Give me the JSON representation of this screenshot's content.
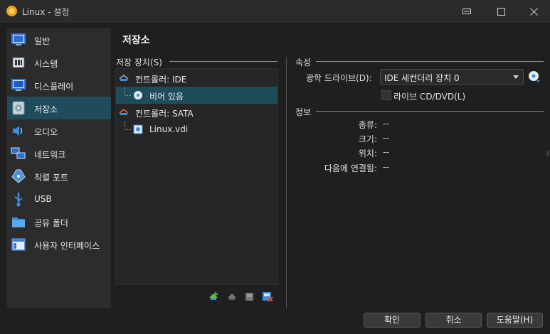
{
  "window": {
    "title": "Linux - 설정"
  },
  "sidebar": {
    "items": [
      {
        "label": "일반",
        "icon": "general-icon"
      },
      {
        "label": "시스템",
        "icon": "system-icon"
      },
      {
        "label": "디스플레이",
        "icon": "display-icon"
      },
      {
        "label": "저장소",
        "icon": "storage-icon",
        "selected": true
      },
      {
        "label": "오디오",
        "icon": "audio-icon"
      },
      {
        "label": "네트워크",
        "icon": "network-icon"
      },
      {
        "label": "직렬 포트",
        "icon": "serial-port-icon"
      },
      {
        "label": "USB",
        "icon": "usb-icon"
      },
      {
        "label": "공유 폴더",
        "icon": "shared-folder-icon"
      },
      {
        "label": "사용자 인터페이스",
        "icon": "user-interface-icon"
      }
    ]
  },
  "page": {
    "title": "저장소"
  },
  "storage": {
    "label": "저장 장치(S)",
    "tree": [
      {
        "text": "컨트롤러: IDE"
      },
      {
        "text": "비어 있음"
      },
      {
        "text": "컨트롤러: SATA"
      },
      {
        "text": "Linux.vdi"
      }
    ]
  },
  "attributes": {
    "label": "속성",
    "optical_drive_label": "광학 드라이브(D):",
    "optical_drive_value": "IDE 세컨더리 장치 0",
    "live_cd_label": "라이브 CD/DVD(L)"
  },
  "info": {
    "label": "정보",
    "rows": [
      {
        "key": "종류:",
        "value": "--"
      },
      {
        "key": "크기:",
        "value": "--"
      },
      {
        "key": "위치:",
        "value": "--"
      },
      {
        "key": "다음에 연결됨:",
        "value": "--"
      }
    ]
  },
  "buttons": {
    "ok": "확인",
    "cancel": "취소",
    "help": "도움말(H)"
  },
  "colors": {
    "selection": "#1f4c5a",
    "background": "#1f1f1f",
    "panel": "#2c2c2c"
  }
}
